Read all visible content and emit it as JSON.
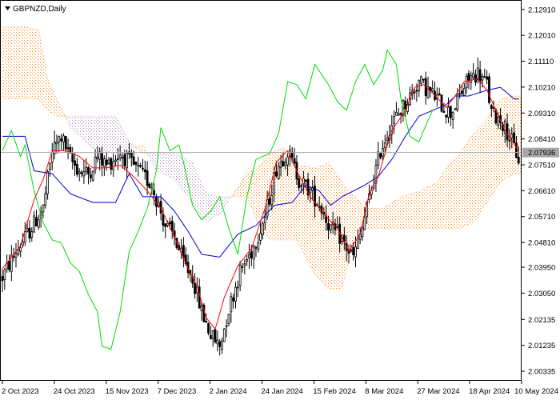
{
  "window": {
    "symbol_label": "GBPNZD,Daily",
    "menu_icon": "triangle-down-icon"
  },
  "chart_data": {
    "type": "candlestick",
    "title": "GBPNZD,Daily",
    "indicator": "Ichimoku Kinko Hyo",
    "current_price": "2.07936",
    "y_ticks": [
      "2.12910",
      "2.12010",
      "2.11110",
      "2.10210",
      "2.09310",
      "2.08410",
      "2.07510",
      "2.06610",
      "2.05710",
      "2.04810",
      "2.03950",
      "2.03050",
      "2.02135",
      "2.01235",
      "2.00335"
    ],
    "x_ticks": [
      "2 Oct 2023",
      "24 Oct 2023",
      "15 Nov 2023",
      "7 Dec 2023",
      "2 Jan 2024",
      "24 Jan 2024",
      "15 Feb 2024",
      "8 Mar 2024",
      "27 Mar 2024",
      "18 Apr 2024",
      "10 May 2024"
    ],
    "ylim": [
      2.0003,
      2.1321
    ],
    "colors": {
      "tenkan": "#ff0000",
      "kijun": "#0000cd",
      "chikou": "#00dd00",
      "kumo_up": "#ff8a1c",
      "kumo_down": "#b08ab8",
      "price_line": "#a8a8a8",
      "candle": "#000000"
    },
    "close_path": [
      [
        0,
        2.036
      ],
      [
        6,
        2.045
      ],
      [
        12,
        2.052
      ],
      [
        18,
        2.06
      ],
      [
        22,
        2.08
      ],
      [
        26,
        2.085
      ],
      [
        30,
        2.077
      ],
      [
        34,
        2.073
      ],
      [
        38,
        2.072
      ],
      [
        42,
        2.078
      ],
      [
        46,
        2.075
      ],
      [
        52,
        2.079
      ],
      [
        60,
        2.073
      ],
      [
        66,
        2.068
      ],
      [
        72,
        2.054
      ],
      [
        76,
        2.05
      ],
      [
        80,
        2.041
      ],
      [
        84,
        2.036
      ],
      [
        88,
        2.024
      ],
      [
        92,
        2.016
      ],
      [
        96,
        2.012
      ],
      [
        100,
        2.025
      ],
      [
        105,
        2.038
      ],
      [
        110,
        2.045
      ],
      [
        116,
        2.057
      ],
      [
        121,
        2.074
      ],
      [
        126,
        2.08
      ],
      [
        131,
        2.07
      ],
      [
        136,
        2.066
      ],
      [
        141,
        2.06
      ],
      [
        145,
        2.053
      ],
      [
        149,
        2.05
      ],
      [
        153,
        2.045
      ],
      [
        155,
        2.043
      ],
      [
        159,
        2.053
      ],
      [
        163,
        2.067
      ],
      [
        167,
        2.08
      ],
      [
        171,
        2.088
      ],
      [
        175,
        2.093
      ],
      [
        180,
        2.099
      ],
      [
        184,
        2.104
      ],
      [
        188,
        2.101
      ],
      [
        192,
        2.098
      ],
      [
        195,
        2.095
      ],
      [
        198,
        2.093
      ],
      [
        202,
        2.099
      ],
      [
        206,
        2.105
      ],
      [
        210,
        2.107
      ],
      [
        214,
        2.103
      ],
      [
        216,
        2.093
      ],
      [
        220,
        2.091
      ],
      [
        224,
        2.085
      ],
      [
        226,
        2.081
      ],
      [
        228,
        2.077
      ]
    ],
    "tenkan": [
      [
        0,
        2.039
      ],
      [
        8,
        2.047
      ],
      [
        14,
        2.063
      ],
      [
        18,
        2.07
      ],
      [
        22,
        2.08
      ],
      [
        28,
        2.08
      ],
      [
        34,
        2.078
      ],
      [
        40,
        2.074
      ],
      [
        46,
        2.074
      ],
      [
        52,
        2.075
      ],
      [
        58,
        2.071
      ],
      [
        64,
        2.066
      ],
      [
        70,
        2.06
      ],
      [
        76,
        2.05
      ],
      [
        82,
        2.039
      ],
      [
        86,
        2.033
      ],
      [
        90,
        2.022
      ],
      [
        94,
        2.018
      ],
      [
        98,
        2.029
      ],
      [
        104,
        2.04
      ],
      [
        110,
        2.046
      ],
      [
        116,
        2.06
      ],
      [
        121,
        2.076
      ],
      [
        126,
        2.08
      ],
      [
        130,
        2.073
      ],
      [
        136,
        2.064
      ],
      [
        142,
        2.058
      ],
      [
        148,
        2.053
      ],
      [
        153,
        2.045
      ],
      [
        158,
        2.051
      ],
      [
        162,
        2.065
      ],
      [
        166,
        2.071
      ],
      [
        172,
        2.087
      ],
      [
        178,
        2.094
      ],
      [
        182,
        2.102
      ],
      [
        186,
        2.103
      ],
      [
        190,
        2.1
      ],
      [
        196,
        2.095
      ],
      [
        200,
        2.099
      ],
      [
        204,
        2.104
      ],
      [
        210,
        2.105
      ],
      [
        214,
        2.101
      ],
      [
        218,
        2.094
      ],
      [
        222,
        2.087
      ],
      [
        228,
        2.08
      ]
    ],
    "kijun": [
      [
        0,
        2.085
      ],
      [
        10,
        2.085
      ],
      [
        14,
        2.073
      ],
      [
        22,
        2.072
      ],
      [
        30,
        2.065
      ],
      [
        40,
        2.062
      ],
      [
        50,
        2.062
      ],
      [
        56,
        2.072
      ],
      [
        62,
        2.064
      ],
      [
        70,
        2.064
      ],
      [
        76,
        2.059
      ],
      [
        82,
        2.052
      ],
      [
        88,
        2.044
      ],
      [
        96,
        2.043
      ],
      [
        104,
        2.051
      ],
      [
        112,
        2.054
      ],
      [
        120,
        2.061
      ],
      [
        128,
        2.062
      ],
      [
        134,
        2.068
      ],
      [
        140,
        2.066
      ],
      [
        145,
        2.061
      ],
      [
        150,
        2.064
      ],
      [
        160,
        2.068
      ],
      [
        166,
        2.071
      ],
      [
        172,
        2.077
      ],
      [
        178,
        2.085
      ],
      [
        184,
        2.092
      ],
      [
        190,
        2.094
      ],
      [
        196,
        2.096
      ],
      [
        200,
        2.099
      ],
      [
        206,
        2.099
      ],
      [
        214,
        2.101
      ],
      [
        220,
        2.102
      ],
      [
        226,
        2.098
      ],
      [
        228,
        2.098
      ]
    ],
    "chikou": [
      [
        0,
        2.08
      ],
      [
        4,
        2.087
      ],
      [
        8,
        2.078
      ],
      [
        10,
        2.082
      ],
      [
        14,
        2.066
      ],
      [
        18,
        2.055
      ],
      [
        22,
        2.049
      ],
      [
        26,
        2.048
      ],
      [
        30,
        2.041
      ],
      [
        34,
        2.038
      ],
      [
        38,
        2.03
      ],
      [
        42,
        2.024
      ],
      [
        44,
        2.012
      ],
      [
        48,
        2.011
      ],
      [
        52,
        2.024
      ],
      [
        56,
        2.045
      ],
      [
        60,
        2.052
      ],
      [
        64,
        2.06
      ],
      [
        68,
        2.073
      ],
      [
        70,
        2.088
      ],
      [
        74,
        2.08
      ],
      [
        78,
        2.082
      ],
      [
        80,
        2.076
      ],
      [
        84,
        2.061
      ],
      [
        88,
        2.056
      ],
      [
        92,
        2.059
      ],
      [
        96,
        2.064
      ],
      [
        100,
        2.053
      ],
      [
        104,
        2.044
      ],
      [
        108,
        2.064
      ],
      [
        112,
        2.077
      ],
      [
        118,
        2.079
      ],
      [
        122,
        2.086
      ],
      [
        126,
        2.104
      ],
      [
        130,
        2.103
      ],
      [
        134,
        2.098
      ],
      [
        138,
        2.11
      ],
      [
        144,
        2.103
      ],
      [
        148,
        2.097
      ],
      [
        152,
        2.094
      ],
      [
        156,
        2.104
      ],
      [
        160,
        2.11
      ],
      [
        164,
        2.103
      ],
      [
        168,
        2.108
      ],
      [
        170,
        2.115
      ],
      [
        174,
        2.11
      ],
      [
        176,
        2.098
      ],
      [
        180,
        2.085
      ],
      [
        184,
        2.083
      ],
      [
        186,
        2.087
      ],
      [
        190,
        2.094
      ]
    ],
    "kumo_a": [
      [
        0,
        2.123
      ],
      [
        10,
        2.123
      ],
      [
        16,
        2.122
      ],
      [
        20,
        2.105
      ],
      [
        24,
        2.098
      ],
      [
        30,
        2.088
      ],
      [
        40,
        2.081
      ],
      [
        50,
        2.079
      ],
      [
        56,
        2.081
      ],
      [
        62,
        2.082
      ],
      [
        68,
        2.073
      ],
      [
        76,
        2.07
      ],
      [
        84,
        2.062
      ],
      [
        90,
        2.055
      ],
      [
        96,
        2.058
      ],
      [
        102,
        2.065
      ],
      [
        108,
        2.072
      ],
      [
        114,
        2.075
      ],
      [
        118,
        2.079
      ],
      [
        124,
        2.081
      ],
      [
        130,
        2.075
      ],
      [
        138,
        2.074
      ],
      [
        144,
        2.076
      ],
      [
        150,
        2.069
      ],
      [
        156,
        2.064
      ],
      [
        160,
        2.06
      ],
      [
        168,
        2.06
      ],
      [
        176,
        2.064
      ],
      [
        184,
        2.066
      ],
      [
        192,
        2.069
      ],
      [
        196,
        2.074
      ],
      [
        202,
        2.079
      ],
      [
        208,
        2.086
      ],
      [
        214,
        2.091
      ],
      [
        220,
        2.098
      ],
      [
        226,
        2.099
      ],
      [
        230,
        2.099
      ]
    ],
    "kumo_b": [
      [
        0,
        2.098
      ],
      [
        10,
        2.098
      ],
      [
        16,
        2.098
      ],
      [
        20,
        2.094
      ],
      [
        24,
        2.092
      ],
      [
        30,
        2.092
      ],
      [
        40,
        2.092
      ],
      [
        50,
        2.092
      ],
      [
        56,
        2.083
      ],
      [
        62,
        2.079
      ],
      [
        68,
        2.079
      ],
      [
        76,
        2.079
      ],
      [
        84,
        2.076
      ],
      [
        90,
        2.065
      ],
      [
        96,
        2.064
      ],
      [
        102,
        2.064
      ],
      [
        108,
        2.064
      ],
      [
        114,
        2.053
      ],
      [
        118,
        2.049
      ],
      [
        124,
        2.049
      ],
      [
        130,
        2.049
      ],
      [
        138,
        2.037
      ],
      [
        144,
        2.032
      ],
      [
        150,
        2.032
      ],
      [
        156,
        2.052
      ],
      [
        160,
        2.053
      ],
      [
        168,
        2.053
      ],
      [
        176,
        2.053
      ],
      [
        184,
        2.053
      ],
      [
        192,
        2.053
      ],
      [
        196,
        2.053
      ],
      [
        202,
        2.053
      ],
      [
        208,
        2.055
      ],
      [
        214,
        2.062
      ],
      [
        220,
        2.069
      ],
      [
        226,
        2.072
      ],
      [
        230,
        2.072
      ]
    ]
  }
}
